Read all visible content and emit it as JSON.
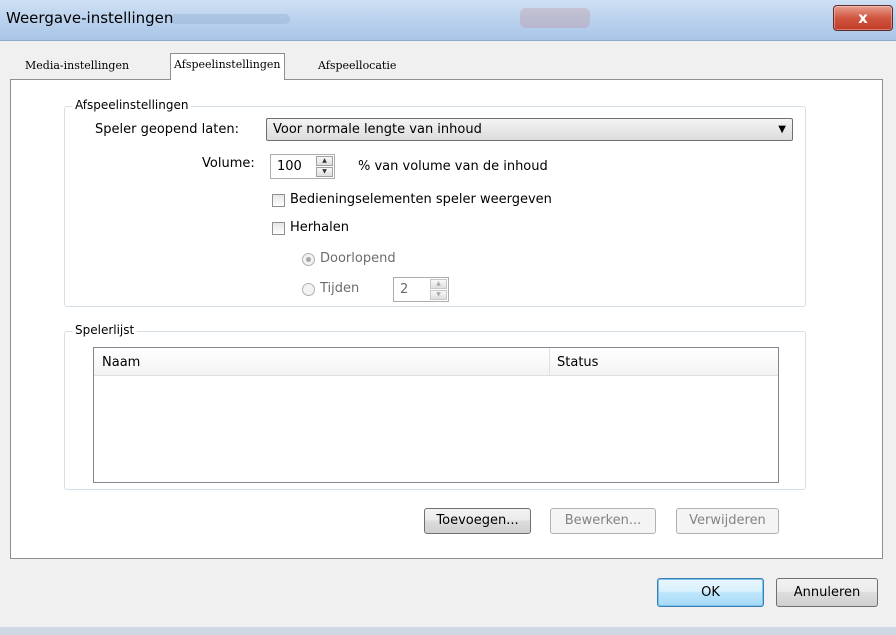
{
  "window": {
    "title": "Weergave-instellingen",
    "close_glyph": "x",
    "close_icon": "close-icon"
  },
  "tabs": [
    {
      "label": "Media-instellingen",
      "active": false
    },
    {
      "label": "Afspeelinstellingen",
      "active": true
    },
    {
      "label": "Afspeellocatie",
      "active": false
    }
  ],
  "playback": {
    "group_title": "Afspeelinstellingen",
    "keep_open_label": "Speler geopend laten:",
    "keep_open_value": "Voor normale lengte van inhoud",
    "dropdown_icon": "chevron-down-icon",
    "volume_label": "Volume:",
    "volume_value": "100",
    "volume_suffix": "% van volume van de inhoud",
    "show_controls_label": "Bedieningselementen speler weergeven",
    "show_controls_checked": false,
    "repeat_label": "Herhalen",
    "repeat_checked": false,
    "continuous_label": "Doorlopend",
    "continuous_selected": true,
    "times_label": "Tijden",
    "times_value": "2"
  },
  "playerlist": {
    "group_title": "Spelerlijst",
    "columns": [
      "Naam",
      "Status"
    ],
    "rows": [],
    "add_label": "Toevoegen...",
    "edit_label": "Bewerken...",
    "delete_label": "Verwijderen"
  },
  "footer": {
    "ok_label": "OK",
    "cancel_label": "Annuleren"
  },
  "colors": {
    "close_button": "#c13c26",
    "title_bar": "#bcd3ee",
    "default_button_border": "#3c7fb1"
  }
}
